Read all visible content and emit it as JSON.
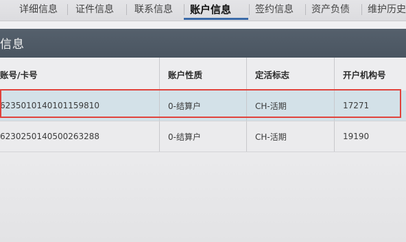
{
  "tabs": [
    {
      "label": "详细信息",
      "active": false
    },
    {
      "label": "证件信息",
      "active": false
    },
    {
      "label": "联系信息",
      "active": false
    },
    {
      "label": "账户信息",
      "active": true
    },
    {
      "label": "签约信息",
      "active": false
    },
    {
      "label": "资产负债",
      "active": false
    },
    {
      "label": "维护历史",
      "active": false
    }
  ],
  "section": {
    "title": "信息"
  },
  "table": {
    "columns": [
      "账号/卡号",
      "账户性质",
      "定活标志",
      "开户机构号"
    ],
    "rows": [
      {
        "account": "6235010140101159810",
        "nature": "0-结算户",
        "type": "CH-活期",
        "branch": "17271",
        "selected": true
      },
      {
        "account": "6230250140500263288",
        "nature": "0-结算户",
        "type": "CH-活期",
        "branch": "19190",
        "selected": false
      }
    ]
  },
  "colors": {
    "header_bg": "#4f5a66",
    "selected_row_bg": "#d3e1e8",
    "selection_border": "#e0423b",
    "active_tab_underline": "#3a6aa8"
  }
}
